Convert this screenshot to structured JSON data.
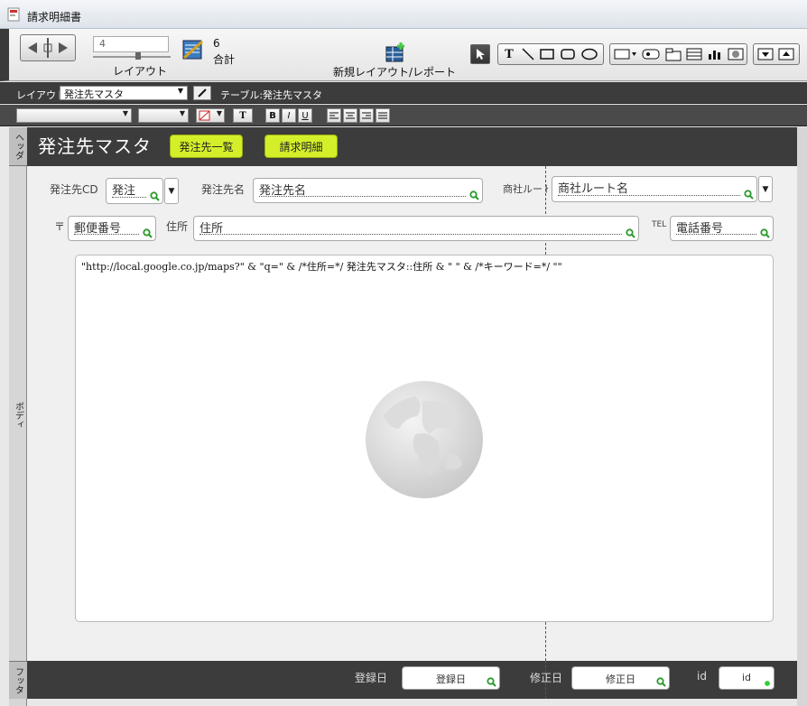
{
  "window": {
    "title": "請求明細書"
  },
  "toolbar": {
    "page_value": "4",
    "layout_label": "レイアウト",
    "total_count": "6",
    "total_label": "合計",
    "new_layout_label": "新規レイアウト/レポート",
    "tools": [
      "pointer-tool",
      "text-tool",
      "line-tool",
      "rectangle-tool",
      "rounded-rect-tool",
      "oval-tool"
    ]
  },
  "layout_bar": {
    "layout_prefix": "レイアウト:",
    "layout_value": "発注先マスタ",
    "table_label": "テーブル:発注先マスタ"
  },
  "format_bar": {
    "bold": "B",
    "italic": "I",
    "underline": "U",
    "text_tool": "T"
  },
  "parts": {
    "header": "ヘッダ",
    "body": "ボディ",
    "footer": "フッタ"
  },
  "header": {
    "title": "発注先マスタ",
    "buttons": [
      "発注先一覧",
      "請求明細"
    ]
  },
  "fields": {
    "order_cd": {
      "label": "発注先CD",
      "value": "発注"
    },
    "order_name": {
      "label": "発注先名",
      "value": "発注先名"
    },
    "route": {
      "label": "商社ルート",
      "value": "商社ルート名"
    },
    "zip": {
      "label": "〒",
      "value": "郵便番号"
    },
    "address": {
      "label": "住所",
      "value": "住所"
    },
    "tel": {
      "label": "TEL",
      "value": "電話番号"
    }
  },
  "webviewer": {
    "formula": "\"http://local.google.co.jp/maps?\" & \"q=\" & /*住所=*/ 発注先マスタ::住所 & \" \" & /*キーワード=*/ \"\""
  },
  "footer": {
    "created_label": "登録日",
    "created_value": "登録日",
    "modified_label": "修正日",
    "modified_value": "修正日",
    "id_label": "id",
    "id_value": "id"
  },
  "colors": {
    "accent_button": "#d4ef2a",
    "dark_bar": "#3c3c3c"
  }
}
